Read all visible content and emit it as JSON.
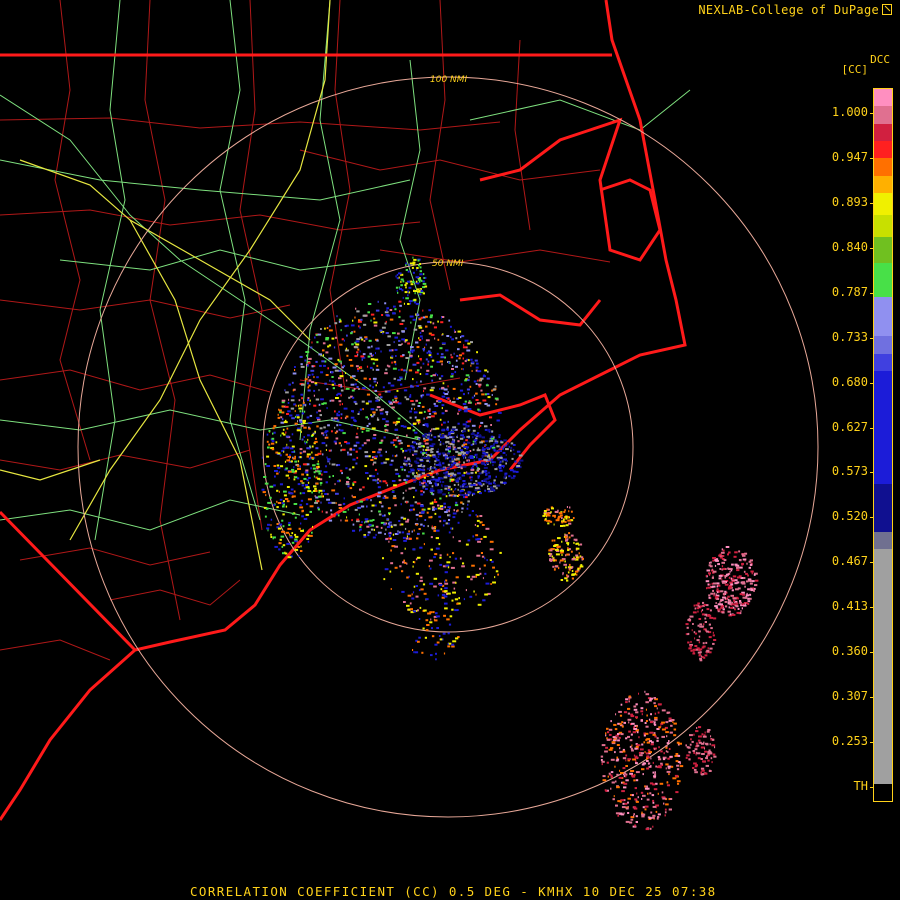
{
  "header": {
    "credit": "NEXLAB-College of DuPage"
  },
  "footer": {
    "caption": "CORRELATION COEFFICIENT (CC) 0.5 DEG - KMHX 10 DEC 25 07:38"
  },
  "colorbar": {
    "product": "DCC",
    "unit": "[CC]",
    "labels": [
      "1.000",
      "0.947",
      "0.893",
      "0.840",
      "0.787",
      "0.733",
      "0.680",
      "0.627",
      "0.573",
      "0.520",
      "0.467",
      "0.413",
      "0.360",
      "0.307",
      "0.253",
      "TH"
    ],
    "segments": [
      {
        "color": "#ff8fc0",
        "span": 0.02
      },
      {
        "color": "#e07090",
        "span": 0.02
      },
      {
        "color": "#d12040",
        "span": 0.02
      },
      {
        "color": "#ff2020",
        "span": 0.02
      },
      {
        "color": "#ff7000",
        "span": 0.02
      },
      {
        "color": "#ffb000",
        "span": 0.02
      },
      {
        "color": "#f0f000",
        "span": 0.025
      },
      {
        "color": "#c8e000",
        "span": 0.025
      },
      {
        "color": "#70c020",
        "span": 0.03
      },
      {
        "color": "#48e048",
        "span": 0.04
      },
      {
        "color": "#9090f0",
        "span": 0.045
      },
      {
        "color": "#7070e0",
        "span": 0.02
      },
      {
        "color": "#4040e0",
        "span": 0.02
      },
      {
        "color": "#1c1cd8",
        "span": 0.13
      },
      {
        "color": "#101090",
        "span": 0.055
      },
      {
        "color": "#707090",
        "span": 0.02
      },
      {
        "color": "#a0a0a0",
        "span": 0.27
      },
      {
        "color": "#000000",
        "span": 0.02
      }
    ]
  },
  "rings": [
    "100 NMI",
    "50 NMI"
  ],
  "colors": {
    "state": "#ff1a1a",
    "county": "#b01818",
    "hwy_green": "#7ee07e",
    "hwy_yellow": "#e6e640",
    "ring": "#e8a898",
    "text": "#ffd21a"
  }
}
